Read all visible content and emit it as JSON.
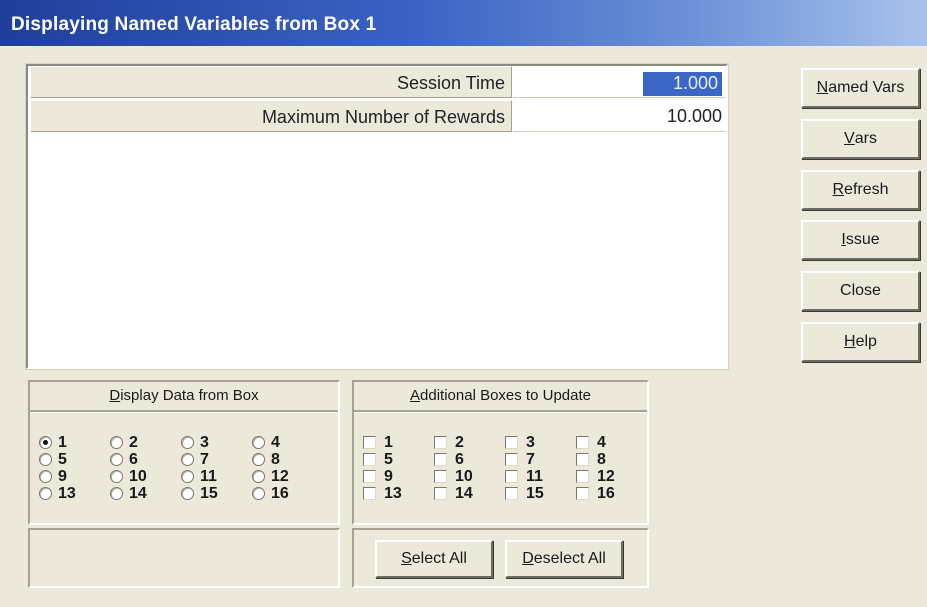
{
  "window": {
    "title": "Displaying Named Variables from Box 1"
  },
  "variables": [
    {
      "name": "Session Time",
      "value": "1.000",
      "selected": true
    },
    {
      "name": "Maximum Number of Rewards",
      "value": "10.000",
      "selected": false
    }
  ],
  "buttons": {
    "named_vars": {
      "hotkey": "N",
      "rest": "amed Vars"
    },
    "vars": {
      "hotkey": "V",
      "rest": "ars"
    },
    "refresh": {
      "hotkey": "R",
      "rest": "efresh"
    },
    "issue": {
      "hotkey": "I",
      "rest": "ssue"
    },
    "close": {
      "label": "Close"
    },
    "help": {
      "hotkey": "H",
      "rest": "elp"
    }
  },
  "display_box": {
    "header": {
      "hotkey": "D",
      "rest": "isplay Data from Box"
    },
    "selected": "1",
    "options": [
      "1",
      "2",
      "3",
      "4",
      "5",
      "6",
      "7",
      "8",
      "9",
      "10",
      "11",
      "12",
      "13",
      "14",
      "15",
      "16"
    ]
  },
  "additional_boxes": {
    "header": {
      "hotkey": "A",
      "rest": "dditional Boxes to Update"
    },
    "options": [
      "1",
      "2",
      "3",
      "4",
      "5",
      "6",
      "7",
      "8",
      "9",
      "10",
      "11",
      "12",
      "13",
      "14",
      "15",
      "16"
    ],
    "select_all": {
      "hotkey": "S",
      "rest": "elect All"
    },
    "deselect_all": {
      "hotkey": "D",
      "rest": "eselect All"
    }
  }
}
